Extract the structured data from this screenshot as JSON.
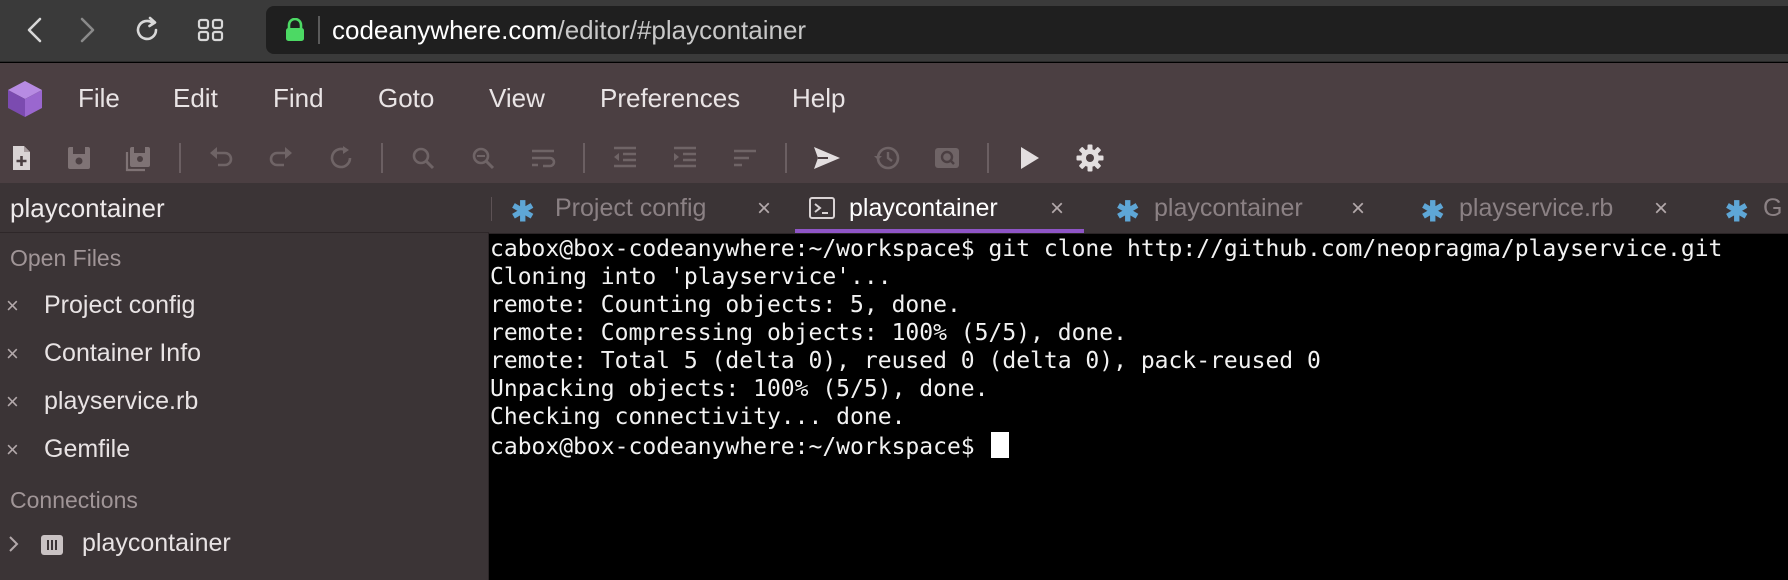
{
  "browser": {
    "url_host": "codeanywhere.com",
    "url_path": "/editor/#playcontainer",
    "icons": [
      "back-icon",
      "forward-icon",
      "reload-icon",
      "grid-icon",
      "lock-icon"
    ]
  },
  "menu": {
    "items": [
      "File",
      "Edit",
      "Find",
      "Goto",
      "View",
      "Preferences",
      "Help"
    ]
  },
  "toolbar": {
    "icons": [
      "new-file-icon",
      "save-icon",
      "save-all-icon",
      "undo-icon",
      "redo-icon",
      "refresh-icon",
      "search-icon",
      "search-replace-icon",
      "wrap-icon",
      "outdent-icon",
      "indent-icon",
      "sort-icon",
      "send-icon",
      "history-icon",
      "preview-icon",
      "run-icon",
      "settings-icon"
    ]
  },
  "sidebar": {
    "title": "playcontainer",
    "open_files_label": "Open Files",
    "open_files": [
      "Project config",
      "Container Info",
      "playservice.rb",
      "Gemfile"
    ],
    "close_glyph": "×",
    "connections_label": "Connections",
    "connections": [
      "playcontainer"
    ]
  },
  "tabs": [
    {
      "label": "Project config",
      "kind": "config",
      "active": false
    },
    {
      "label": "playcontainer",
      "kind": "terminal",
      "active": true
    },
    {
      "label": "playcontainer",
      "kind": "config",
      "active": false
    },
    {
      "label": "playservice.rb",
      "kind": "file",
      "active": false
    },
    {
      "label": "G",
      "kind": "file",
      "active": false
    }
  ],
  "tab_close_glyph": "×",
  "tab_asterisk_glyph": "✱",
  "terminal": {
    "lines": [
      "cabox@box-codeanywhere:~/workspace$ git clone http://github.com/neopragma/playservice.git",
      "Cloning into 'playservice'...",
      "remote: Counting objects: 5, done.",
      "remote: Compressing objects: 100% (5/5), done.",
      "remote: Total 5 (delta 0), reused 0 (delta 0), pack-reused 0",
      "Unpacking objects: 100% (5/5), done.",
      "Checking connectivity... done."
    ],
    "prompt": "cabox@box-codeanywhere:~/workspace$ "
  },
  "colors": {
    "accent_purple": "#8e55c6",
    "tab_asterisk": "#5ea6d6",
    "lock_green": "#4cd964",
    "menubar_bg": "#4b3f42"
  }
}
